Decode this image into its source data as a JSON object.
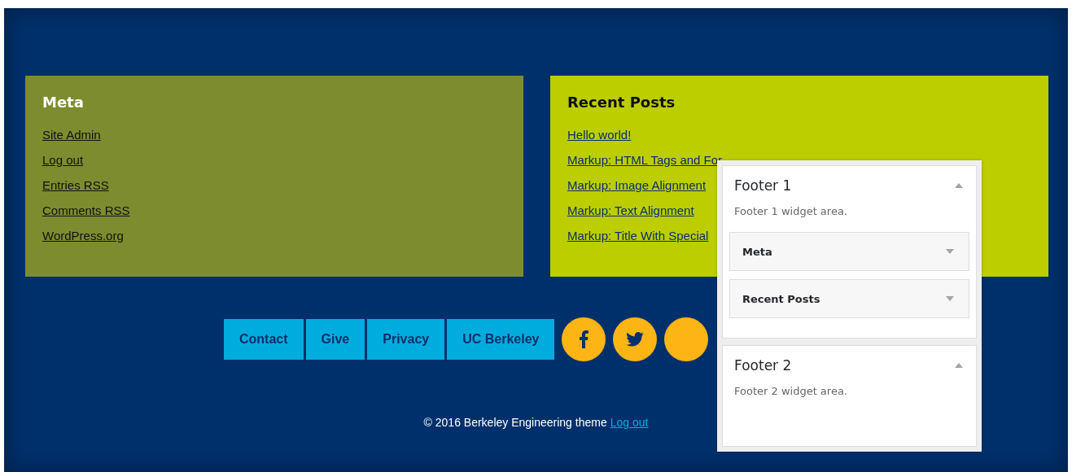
{
  "widgets": [
    {
      "kind": "olive",
      "title": "Meta",
      "links": [
        "Site Admin",
        "Log out",
        "Entries RSS",
        "Comments RSS",
        "WordPress.org"
      ]
    },
    {
      "kind": "lime",
      "title": "Recent Posts",
      "links": [
        "Hello world!",
        "Markup: HTML Tags and For",
        "Markup: Image Alignment",
        "Markup: Text Alignment",
        "Markup: Title With Special"
      ]
    }
  ],
  "nav_buttons": [
    "Contact",
    "Give",
    "Privacy",
    "UC Berkeley"
  ],
  "social": [
    {
      "kind": "facebook"
    },
    {
      "kind": "twitter"
    },
    {
      "kind": "other"
    }
  ],
  "copyright": {
    "text": "© 2016 Berkeley Engineering theme",
    "link": "Log out"
  },
  "customizer": {
    "sections": [
      {
        "title": "Footer 1",
        "description": "Footer 1 widget area.",
        "expanded": true,
        "widgets": [
          {
            "title": "Meta",
            "expanded": false
          },
          {
            "title": "Recent Posts",
            "expanded": false
          }
        ]
      },
      {
        "title": "Footer 2",
        "description": "Footer 2 widget area.",
        "expanded": true
      }
    ]
  }
}
